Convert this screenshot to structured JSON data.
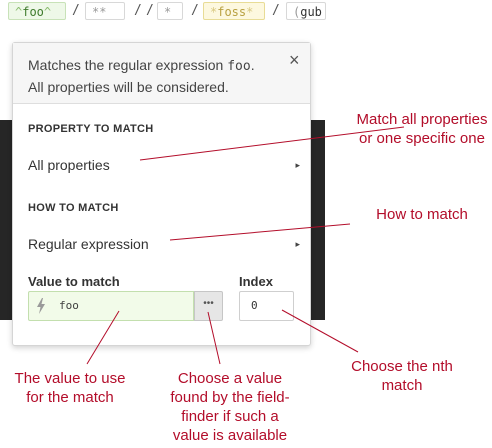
{
  "tokens": {
    "foo": "foo",
    "star_star": "**",
    "star": "*",
    "foss": "foss",
    "gub": "gub",
    "separator": "/"
  },
  "popup": {
    "description_prefix": "Matches the regular expression ",
    "description_code": "foo",
    "description_suffix": ". All properties will be considered.",
    "close_label": "×",
    "property_section_label": "PROPERTY TO MATCH",
    "property_option": "All properties",
    "how_section_label": "HOW TO MATCH",
    "how_option": "Regular expression",
    "value_label": "Value to match",
    "value": "foo",
    "finder_label": "•••",
    "index_label": "Index",
    "index_value": "0",
    "chevron": "▸"
  },
  "annotations": {
    "match_all": "Match all properties or one specific one",
    "how_to_match": "How to match",
    "value_to_use": "The value to use for the match",
    "field_finder": "Choose a value found by the field-finder if such a value is available",
    "nth_match": "Choose the nth match"
  },
  "colors": {
    "annotation": "#b30d2a",
    "value_input_bg": "#f2fbe9"
  },
  "icons": {
    "bolt": "bolt-icon",
    "close": "close-icon",
    "chevron": "chevron-right-icon"
  }
}
